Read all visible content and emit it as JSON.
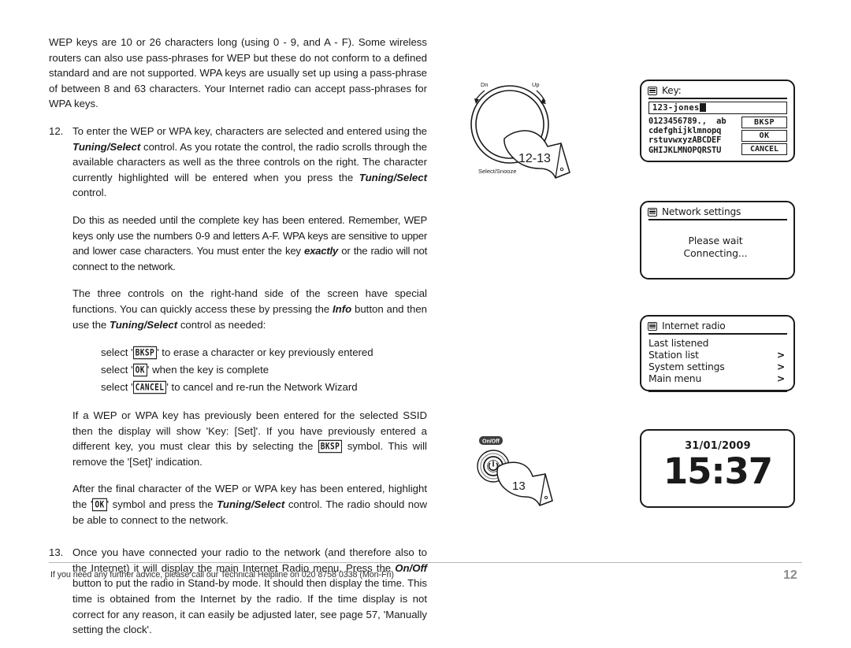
{
  "document": {
    "page_number": "12",
    "footer_note": "If you need any further advice, please call our Technical Helpline on 020 8758 0338 (Mon-Fri)"
  },
  "body": {
    "intro_paragraph": "WEP keys are 10 or 26 characters long (using 0 - 9, and A - F). Some wireless routers can also use pass-phrases for WEP but these do not conform to a defined standard and are not supported. WPA keys are usually set up using a pass-phrase of between 8 and 63 characters. Your Internet radio can accept pass-phrases for WPA keys.",
    "step12": {
      "number": "12.",
      "text_a1": "To enter the WEP or WPA key, characters are selected and entered using the ",
      "bold_a1": "Tuning/Select",
      "text_a2": " control. As you rotate the control, the radio scrolls through the available characters as well as the three controls on the right. The character currently highlighted will be entered when you press the ",
      "bold_a2": "Tuning/Select",
      "text_a3": " control.",
      "para_b1": "Do this as needed until the complete key has been entered. Remember, WEP keys only use the numbers 0-9 and letters A-F. WPA keys are sensitive to upper and lower case characters. You must enter the key ",
      "bold_b1": "exactly",
      "para_b2": " or the radio will not connect to the network.",
      "para_c1": "The three controls on the right-hand side of the screen have special functions. You can quickly access these by pressing the ",
      "bold_c1": "Info",
      "para_c2": " button and then use the ",
      "bold_c2": "Tuning/Select",
      "para_c3": " control as needed:",
      "bullets": [
        {
          "pre": "select '",
          "key": "BKSP",
          "post": "' to erase a character or key previously entered"
        },
        {
          "pre": "select '",
          "key": "OK",
          "post": "' when the key is complete"
        },
        {
          "pre": "select '",
          "key": "CANCEL",
          "post": "' to cancel and re-run the Network Wizard"
        }
      ],
      "para_d1": "If a WEP or WPA key has previously been entered for the selected SSID then the display will show 'Key: [Set]'. If you have previously entered a different key, you must clear this by selecting the ",
      "key_d": "BKSP",
      "para_d2": "symbol.  This will remove the '[Set]' indication.",
      "para_e1": "After the final character of the WEP or WPA key has been entered, highlight the '",
      "key_e": "OK",
      "para_e2": "' symbol and press the ",
      "bold_e": "Tuning/Select",
      "para_e3": " control. The radio should now be able to connect to the network."
    },
    "step13": {
      "number": "13.",
      "text_1": "Once you have connected your radio to the network (and therefore also to the Internet) it will display the main Internet Radio menu. Press the ",
      "bold_1": "On/Off",
      "text_2": " button to put the radio in Stand-by mode. It should then display the time. This time is obtained from the Internet by the radio. If the time display is not correct for any reason, it can easily be adjusted later, see page 57, 'Manually setting the clock'."
    }
  },
  "diagrams": {
    "dial": {
      "label_down": "Dn",
      "label_up": "Up",
      "label_select": "Select/Snooze",
      "step_marker": "12-13"
    },
    "power": {
      "label": "On/Off",
      "step_marker": "13"
    }
  },
  "lcd_panels": {
    "key_entry": {
      "icon": "menu-icon",
      "title": "Key:",
      "input_value": "123-jones",
      "charset_rows": [
        "0123456789.,  ab",
        "cdefghijklmnopq",
        "rstuvwxyzABCDEF",
        "GHIJKLMNOPQRSTU"
      ],
      "softkeys": [
        "BKSP",
        "OK",
        "CANCEL"
      ]
    },
    "network_settings": {
      "icon": "menu-icon",
      "title": "Network settings",
      "message_line1": "Please wait",
      "message_line2": "Connecting..."
    },
    "internet_radio": {
      "icon": "menu-icon",
      "title": "Internet radio",
      "items": [
        {
          "label": "Last listened",
          "chevron": ""
        },
        {
          "label": "Station list",
          "chevron": ">"
        },
        {
          "label": "System settings",
          "chevron": ">"
        },
        {
          "label": "Main menu",
          "chevron": ">"
        }
      ]
    },
    "standby_clock": {
      "date": "31/01/2009",
      "time": "15:37"
    }
  }
}
